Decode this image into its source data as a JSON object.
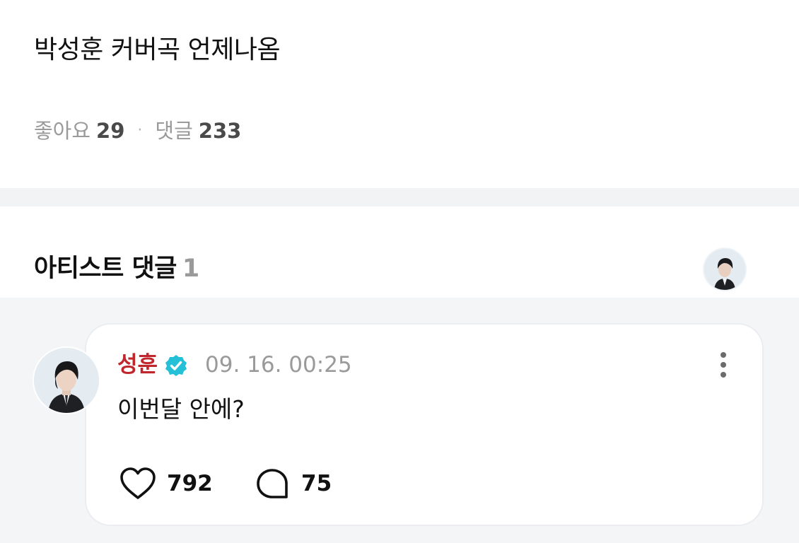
{
  "post": {
    "title": "박성훈 커버곡 언제나옴",
    "likes_label": "좋아요",
    "likes_count": "29",
    "separator": "·",
    "comments_label": "댓글",
    "comments_count": "233"
  },
  "artist_comments": {
    "heading": "아티스트 댓글",
    "count": "1"
  },
  "comment": {
    "author": "성훈",
    "timestamp": "09. 16. 00:25",
    "text": "이번달 안에?",
    "like_count": "792",
    "reply_count": "75"
  },
  "colors": {
    "author": "#c0272d",
    "verified_badge": "#23c0d8",
    "band": "#f2f3f5"
  },
  "icons": {
    "verified": "verified-badge-icon",
    "more": "more-vertical-icon",
    "like": "heart-outline-icon",
    "reply": "speech-bubble-icon"
  }
}
